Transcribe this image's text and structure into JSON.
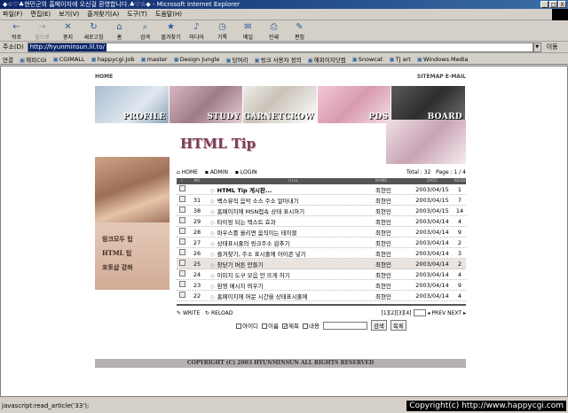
{
  "window": {
    "title": "◆☆♡♣현민군의 홈페이지에 오신걸 환영합니다.♣♡☆◆ - Microsoft Internet Explorer",
    "controls": [
      "_",
      "□",
      "X"
    ]
  },
  "menu": [
    "파일(F)",
    "편집(E)",
    "보기(V)",
    "즐겨찾기(A)",
    "도구(T)",
    "도움말(H)"
  ],
  "toolbar": [
    {
      "label": "뒤로",
      "icon": "back-arrow-icon",
      "glyph": "←",
      "enabled": true
    },
    {
      "label": "앞으로",
      "icon": "forward-arrow-icon",
      "glyph": "→",
      "enabled": false
    },
    {
      "label": "중지",
      "icon": "stop-icon",
      "glyph": "✕",
      "enabled": true
    },
    {
      "label": "새로고침",
      "icon": "refresh-icon",
      "glyph": "↻",
      "enabled": true
    },
    {
      "label": "홈",
      "icon": "home-icon",
      "glyph": "⌂",
      "enabled": true
    },
    {
      "label": "검색",
      "icon": "search-icon",
      "glyph": "⌕",
      "enabled": true
    },
    {
      "label": "즐겨찾기",
      "icon": "favorites-icon",
      "glyph": "★",
      "enabled": true
    },
    {
      "label": "미디어",
      "icon": "media-icon",
      "glyph": "♪",
      "enabled": true
    },
    {
      "label": "기록",
      "icon": "history-icon",
      "glyph": "◷",
      "enabled": true
    },
    {
      "label": "메일",
      "icon": "mail-icon",
      "glyph": "✉",
      "enabled": true
    },
    {
      "label": "인쇄",
      "icon": "print-icon",
      "glyph": "⎙",
      "enabled": true
    },
    {
      "label": "편집",
      "icon": "edit-icon",
      "glyph": "✎",
      "enabled": true
    }
  ],
  "address": {
    "label": "주소(D)",
    "url": "http://hyunminsun.lil.to/",
    "go": "이동"
  },
  "links": {
    "label": "연결",
    "items": [
      "해피CGI",
      "CGIMALL",
      "happycgi.Job",
      "master",
      "Design Jungle",
      "당여리",
      "링크 사용자 정의",
      "해피이지닷컴",
      "Snowcat",
      "TJ art",
      "Windows Media"
    ]
  },
  "site": {
    "top_left": "HOME",
    "top_right": [
      "SITEMAP",
      "E-MAIL"
    ],
    "nav": [
      "PROFILE",
      "STUDY",
      "GARNETCROW",
      "PDS",
      "BOARD"
    ],
    "section_title": "HTML Tip",
    "left_menu": [
      "링크모두 팁",
      "HTML 팁",
      "포토샵 강좌"
    ],
    "board_links": [
      "HOME",
      "ADMIN",
      "LOGIN"
    ],
    "total": "Total : 32",
    "page": "Page : 1 / 4",
    "columns": [
      "NO",
      "TITLE",
      "NAME",
      "DATE",
      "READ"
    ],
    "rows": [
      {
        "no": "",
        "title": "HTML Tip 게시판...",
        "name": "최현민",
        "date": "2003/04/15",
        "read": "1",
        "notice": true
      },
      {
        "no": "31",
        "title": "백스뮤직 음악 소스 주소 알아내기",
        "name": "최현민",
        "date": "2003/04/15",
        "read": "7"
      },
      {
        "no": "38",
        "title": "홈페이지에 MSN접속 상태 표시하기",
        "name": "최현민",
        "date": "2003/04/15",
        "read": "14"
      },
      {
        "no": "29",
        "title": "타이핑 되는 텍스트 효과",
        "name": "최현민",
        "date": "2003/04/14",
        "read": "4"
      },
      {
        "no": "28",
        "title": "마우스를 올리면 움직이는 테이블",
        "name": "최현민",
        "date": "2003/04/14",
        "read": "9"
      },
      {
        "no": "27",
        "title": "상태표시줄의 링크주소 감추기",
        "name": "최현민",
        "date": "2003/04/14",
        "read": "2"
      },
      {
        "no": "26",
        "title": "즐겨찾기, 주소 표시줄에 아이콘 넣기",
        "name": "최현민",
        "date": "2003/04/14",
        "read": "3"
      },
      {
        "no": "25",
        "title": "창닫기 버튼 만들기",
        "name": "최현민",
        "date": "2003/04/14",
        "read": "2",
        "highlight": true
      },
      {
        "no": "24",
        "title": "이미지 도구 모음 안 뜨게 하기",
        "name": "최현민",
        "date": "2003/04/14",
        "read": "4"
      },
      {
        "no": "23",
        "title": "환영 메시지 띄우기",
        "name": "최현민",
        "date": "2003/04/14",
        "read": "9"
      },
      {
        "no": "22",
        "title": "홈페이지에 머문 시간을 상태표시줄에",
        "name": "최현민",
        "date": "2003/04/14",
        "read": "4"
      }
    ],
    "write": "WRITE",
    "reload": "RELOAD",
    "pagination": "[1][2][3][4]",
    "prev": "PREV",
    "next": "NEXT",
    "search_opts": [
      {
        "label": "아이디",
        "checked": false
      },
      {
        "label": "이름",
        "checked": false
      },
      {
        "label": "제목",
        "checked": true
      },
      {
        "label": "내용",
        "checked": false
      }
    ],
    "search_btn": "검색",
    "list_btn": "목록",
    "copyright": "COPYRIGHT (C) 2003 HYUNMINSUN ALL RIGHTS RESERVED"
  },
  "status": {
    "text": "javascript:read_article('33');",
    "watermark": "Copyright(c) http://www.happycgi.com"
  }
}
